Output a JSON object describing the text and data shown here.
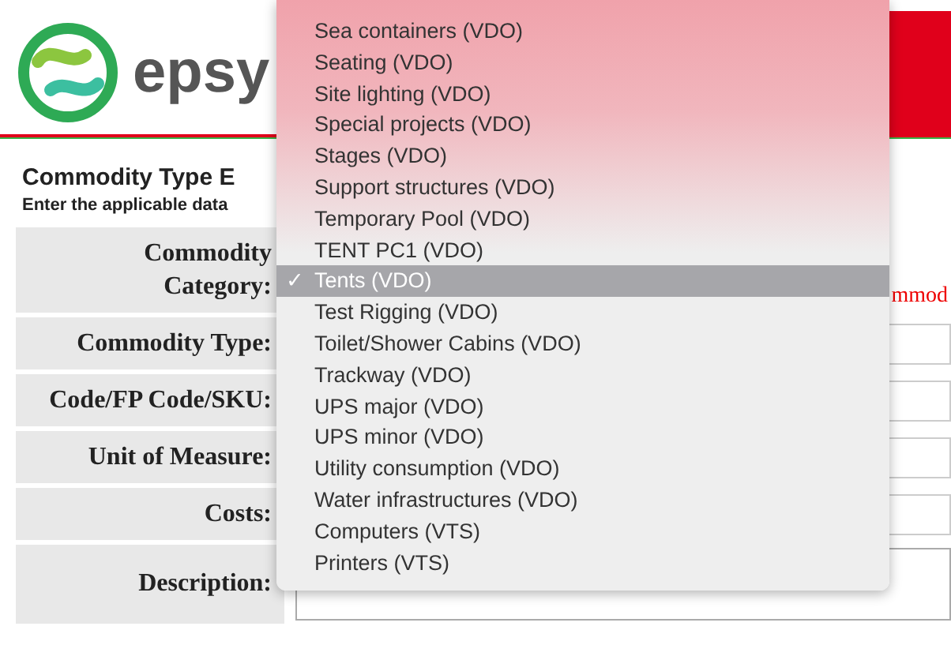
{
  "header": {
    "logo_text": "epsy"
  },
  "page": {
    "title": "Commodity Type E",
    "subtitle": "Enter the applicable data"
  },
  "form": {
    "rows": [
      {
        "label": "Commodity Category:",
        "kind": "select",
        "note": "mmod"
      },
      {
        "label": "Commodity Type:",
        "kind": "input"
      },
      {
        "label": "Code/FP Code/SKU:",
        "kind": "input"
      },
      {
        "label": "Unit of Measure:",
        "kind": "input"
      },
      {
        "label": "Costs:",
        "kind": "input"
      },
      {
        "label": "Description:",
        "kind": "textarea"
      }
    ]
  },
  "dropdown": {
    "check_mark": "✓",
    "options": [
      {
        "label": "Sea containers (VDO)",
        "selected": false
      },
      {
        "label": "Seating (VDO)",
        "selected": false
      },
      {
        "label": "Site lighting (VDO)",
        "selected": false
      },
      {
        "label": "Special projects (VDO)",
        "selected": false
      },
      {
        "label": "Stages (VDO)",
        "selected": false
      },
      {
        "label": "Support structures (VDO)",
        "selected": false
      },
      {
        "label": "Temporary Pool (VDO)",
        "selected": false
      },
      {
        "label": "TENT PC1 (VDO)",
        "selected": false
      },
      {
        "label": "Tents (VDO)",
        "selected": true
      },
      {
        "label": "Test Rigging (VDO)",
        "selected": false
      },
      {
        "label": "Toilet/Shower Cabins (VDO)",
        "selected": false
      },
      {
        "label": "Trackway (VDO)",
        "selected": false
      },
      {
        "label": "UPS major (VDO)",
        "selected": false
      },
      {
        "label": "UPS minor (VDO)",
        "selected": false
      },
      {
        "label": "Utility consumption (VDO)",
        "selected": false
      },
      {
        "label": "Water infrastructures (VDO)",
        "selected": false
      },
      {
        "label": "Computers (VTS)",
        "selected": false
      },
      {
        "label": "Printers (VTS)",
        "selected": false
      }
    ]
  }
}
